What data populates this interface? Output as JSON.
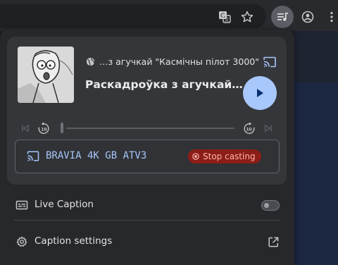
{
  "toolbar": {
    "icons": [
      "translate-icon",
      "star-icon",
      "media-controls-icon",
      "profile-icon",
      "more-vert-icon"
    ]
  },
  "media": {
    "source": "…з агучкай \"Касмічны пілот 3000\"",
    "title": "Раскадроўка з агучкай…",
    "state": "paused",
    "progress_fraction": 0.0,
    "seek_back_seconds": "10",
    "seek_forward_seconds": "10"
  },
  "cast": {
    "device_name": "BRAVIA 4K GB ATV3",
    "stop_label": "Stop casting"
  },
  "live_caption": {
    "label": "Live Caption",
    "enabled": false
  },
  "caption_settings": {
    "label": "Caption settings"
  },
  "colors": {
    "accent": "#a8c7fa",
    "stop_bg": "#8c1d18",
    "stop_text": "#ffb4ab"
  }
}
